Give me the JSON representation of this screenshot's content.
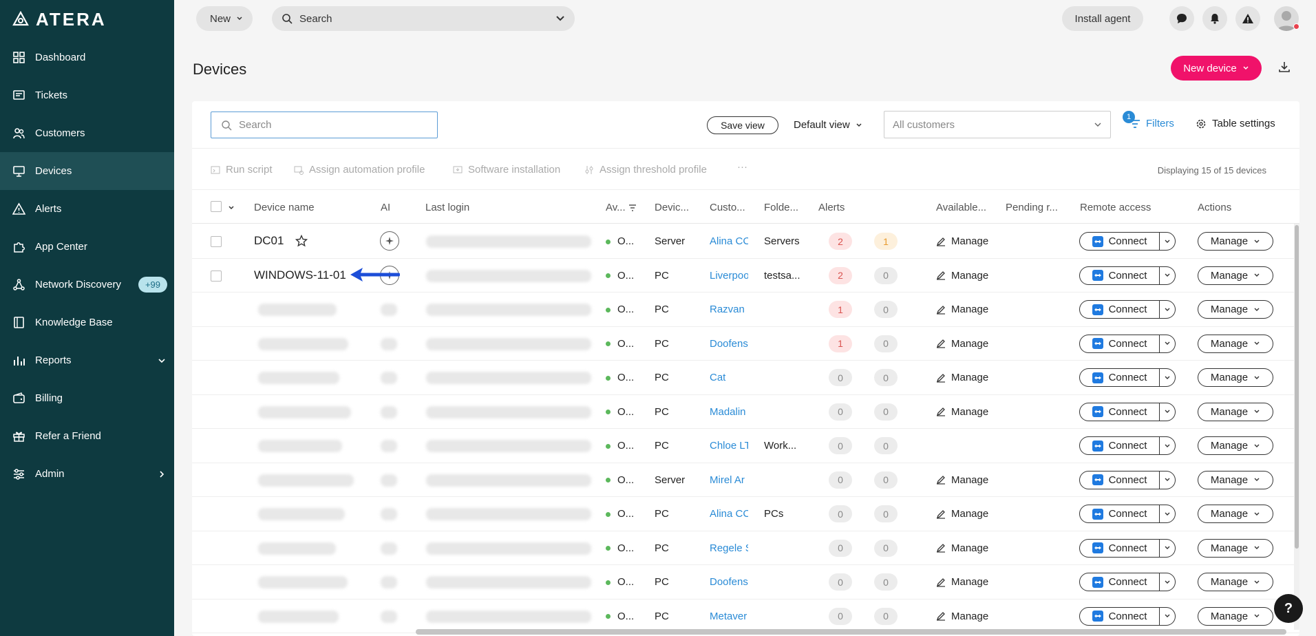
{
  "app": {
    "logo_text": "ATERA"
  },
  "sidebar": {
    "items": [
      {
        "label": "Dashboard",
        "icon": "dashboard-icon"
      },
      {
        "label": "Tickets",
        "icon": "tickets-icon"
      },
      {
        "label": "Customers",
        "icon": "customers-icon"
      },
      {
        "label": "Devices",
        "icon": "devices-icon",
        "active": true
      },
      {
        "label": "Alerts",
        "icon": "alert-icon"
      },
      {
        "label": "App Center",
        "icon": "puzzle-icon"
      },
      {
        "label": "Network Discovery",
        "icon": "network-icon",
        "badge": "+99"
      },
      {
        "label": "Knowledge Base",
        "icon": "book-icon"
      },
      {
        "label": "Reports",
        "icon": "chart-icon",
        "chevron": "down"
      },
      {
        "label": "Billing",
        "icon": "wallet-icon"
      },
      {
        "label": "Refer a Friend",
        "icon": "gift-icon"
      },
      {
        "label": "Admin",
        "icon": "sliders-icon",
        "chevron": "right"
      }
    ]
  },
  "topbar": {
    "new_label": "New",
    "search_placeholder": "Search",
    "install_label": "Install agent"
  },
  "page": {
    "title": "Devices",
    "new_device_label": "New device"
  },
  "toolbar": {
    "search_placeholder": "Search",
    "save_view_label": "Save view",
    "default_view_label": "Default view",
    "customers_placeholder": "All customers",
    "filters_label": "Filters",
    "filters_count": "1",
    "table_settings_label": "Table settings"
  },
  "actions": {
    "run_script": "Run script",
    "assign_automation": "Assign automation profile",
    "software_install": "Software installation",
    "assign_threshold": "Assign threshold profile",
    "more": "···",
    "displaying": "Displaying 15 of 15 devices"
  },
  "table": {
    "headers": {
      "device_name": "Device name",
      "ai": "AI",
      "last_login": "Last login",
      "availability": "Av...",
      "device_type": "Devic...",
      "customer": "Custo...",
      "folder": "Folde...",
      "alerts": "Alerts",
      "available": "Available...",
      "pending": "Pending r...",
      "remote": "Remote access",
      "actions": "Actions"
    },
    "connect_label": "Connect",
    "manage_label": "Manage",
    "manage_link_label": "Manage",
    "status_text": "O...",
    "rows": [
      {
        "name": "DC01",
        "star": true,
        "type": "Server",
        "customer": "Alina CC",
        "folder": "Servers",
        "alerts_a": "2",
        "alerts_a_color": "red",
        "alerts_b": "1",
        "alerts_b_color": "orange",
        "manage_link": true
      },
      {
        "name": "WINDOWS-11-01",
        "type": "PC",
        "customer": "Liverpoo",
        "folder": "testsa...",
        "alerts_a": "2",
        "alerts_a_color": "red",
        "alerts_b": "0",
        "alerts_b_color": "gray",
        "manage_link": true
      },
      {
        "name": "",
        "type": "PC",
        "customer": "Razvan",
        "folder": "",
        "alerts_a": "1",
        "alerts_a_color": "red",
        "alerts_b": "0",
        "alerts_b_color": "gray",
        "manage_link": true
      },
      {
        "name": "",
        "type": "PC",
        "customer": "Doofens",
        "folder": "",
        "alerts_a": "1",
        "alerts_a_color": "red",
        "alerts_b": "0",
        "alerts_b_color": "gray",
        "manage_link": true
      },
      {
        "name": "",
        "type": "PC",
        "customer": "Cat",
        "folder": "",
        "alerts_a": "0",
        "alerts_a_color": "gray",
        "alerts_b": "0",
        "alerts_b_color": "gray",
        "manage_link": true
      },
      {
        "name": "",
        "type": "PC",
        "customer": "Madalin",
        "folder": "",
        "alerts_a": "0",
        "alerts_a_color": "gray",
        "alerts_b": "0",
        "alerts_b_color": "gray",
        "manage_link": true
      },
      {
        "name": "",
        "type": "PC",
        "customer": "Chloe LT",
        "folder": "Work...",
        "alerts_a": "0",
        "alerts_a_color": "gray",
        "alerts_b": "0",
        "alerts_b_color": "gray",
        "manage_link": false
      },
      {
        "name": "",
        "type": "Server",
        "customer": "Mirel Ar",
        "folder": "",
        "alerts_a": "0",
        "alerts_a_color": "gray",
        "alerts_b": "0",
        "alerts_b_color": "gray",
        "manage_link": true
      },
      {
        "name": "",
        "type": "PC",
        "customer": "Alina CC",
        "folder": "PCs",
        "alerts_a": "0",
        "alerts_a_color": "gray",
        "alerts_b": "0",
        "alerts_b_color": "gray",
        "manage_link": true
      },
      {
        "name": "",
        "type": "PC",
        "customer": "Regele S",
        "folder": "",
        "alerts_a": "0",
        "alerts_a_color": "gray",
        "alerts_b": "0",
        "alerts_b_color": "gray",
        "manage_link": true
      },
      {
        "name": "",
        "type": "PC",
        "customer": "Doofens",
        "folder": "",
        "alerts_a": "0",
        "alerts_a_color": "gray",
        "alerts_b": "0",
        "alerts_b_color": "gray",
        "manage_link": true
      },
      {
        "name": "",
        "type": "PC",
        "customer": "Metaver",
        "folder": "",
        "alerts_a": "0",
        "alerts_a_color": "gray",
        "alerts_b": "0",
        "alerts_b_color": "gray",
        "manage_link": true
      }
    ]
  },
  "colors": {
    "sidebar_bg": "#0e3a40",
    "accent_pink": "#f0126a",
    "link_blue": "#2a8bd6",
    "annotation_arrow": "#1d4ed8"
  },
  "help_label": "?"
}
